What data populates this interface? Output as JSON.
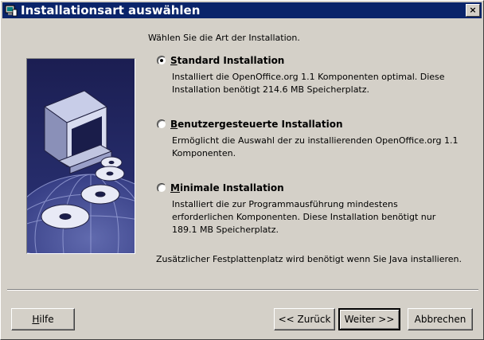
{
  "window": {
    "title": "Installationsart auswählen",
    "close_glyph": "×"
  },
  "intro": "Wählen Sie die Art der Installation.",
  "options": [
    {
      "title_first": "S",
      "title_rest": "tandard Installation",
      "selected": true,
      "desc": [
        "Installiert die OpenOffice.org 1.1 Komponenten optimal. Diese",
        "Installation benötigt 214.6 MB Speicherplatz."
      ]
    },
    {
      "title_first": "B",
      "title_rest": "enutzergesteuerte Installation",
      "selected": false,
      "desc": [
        "Ermöglicht die Auswahl der zu installierenden OpenOffice.org 1.1",
        "Komponenten."
      ]
    },
    {
      "title_first": "M",
      "title_rest": "inimale Installation",
      "selected": false,
      "desc": [
        "Installiert die zur Programmausführung mindestens",
        "erforderlichen Komponenten. Diese Installation benötigt nur",
        "189.1 MB Speicherplatz."
      ]
    }
  ],
  "footer_note": "Zusätzlicher Festplattenplatz wird benötigt wenn Sie Java installieren.",
  "buttons": {
    "help_first": "H",
    "help_rest": "ilfe",
    "back": "<< Zurück",
    "next": "Weiter >>",
    "cancel": "Abbrechen"
  },
  "colors": {
    "titlebar": "#0a246a",
    "dialog": "#d4d0c8",
    "image_bg": "#1a1d4a"
  }
}
